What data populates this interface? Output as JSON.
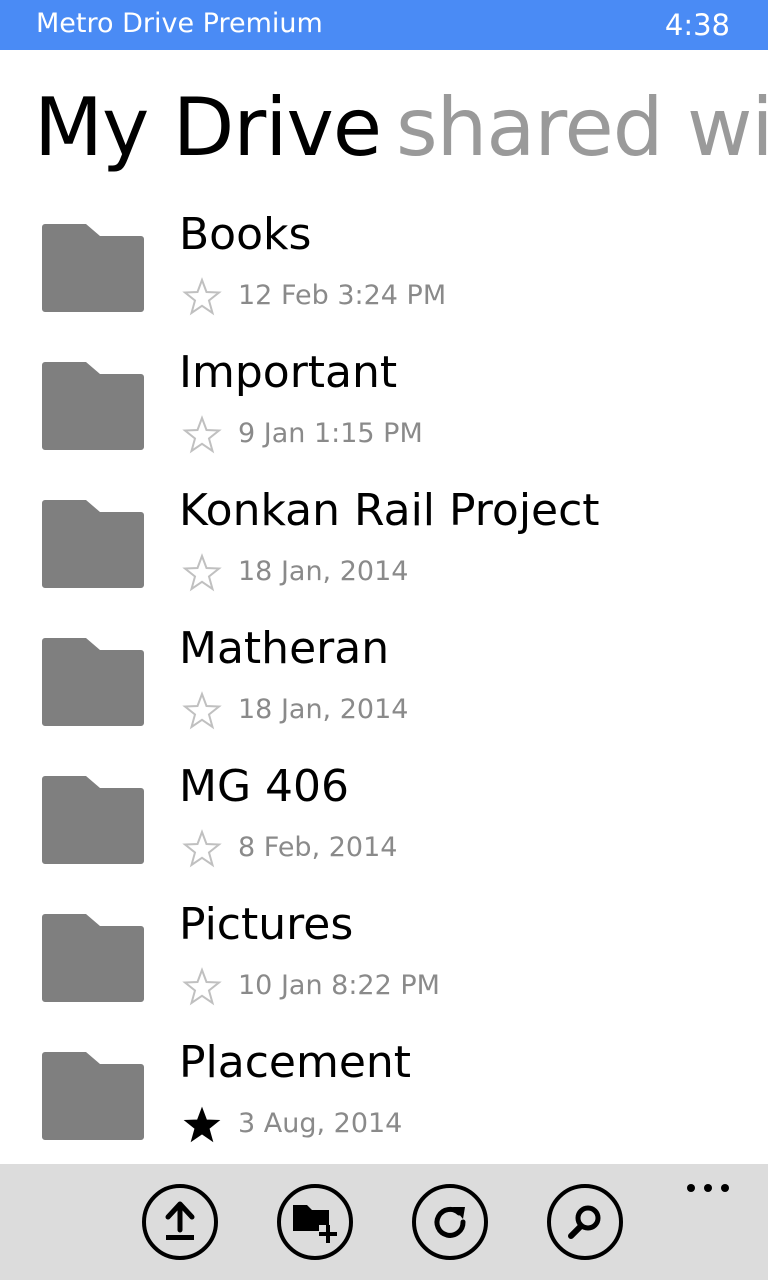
{
  "status_bar": {
    "app_title": "Metro Drive Premium",
    "time": "4:38",
    "color": "#4a8bf5"
  },
  "pivot": {
    "active": "My Drive",
    "next": "shared wit"
  },
  "items": [
    {
      "name": "Books",
      "date": "12 Feb 3:24 PM",
      "starred": false
    },
    {
      "name": "Important",
      "date": "9 Jan 1:15 PM",
      "starred": false
    },
    {
      "name": "Konkan Rail Project",
      "date": "18 Jan, 2014",
      "starred": false
    },
    {
      "name": "Matheran",
      "date": "18 Jan, 2014",
      "starred": false
    },
    {
      "name": "MG 406",
      "date": "8 Feb, 2014",
      "starred": false
    },
    {
      "name": "Pictures",
      "date": "10 Jan 8:22 PM",
      "starred": false
    },
    {
      "name": "Placement",
      "date": "3 Aug, 2014",
      "starred": true
    }
  ],
  "app_bar": {
    "buttons": [
      {
        "icon": "upload-icon"
      },
      {
        "icon": "new-folder-icon"
      },
      {
        "icon": "refresh-icon"
      },
      {
        "icon": "search-icon"
      }
    ],
    "more_icon": "ellipsis-icon"
  }
}
